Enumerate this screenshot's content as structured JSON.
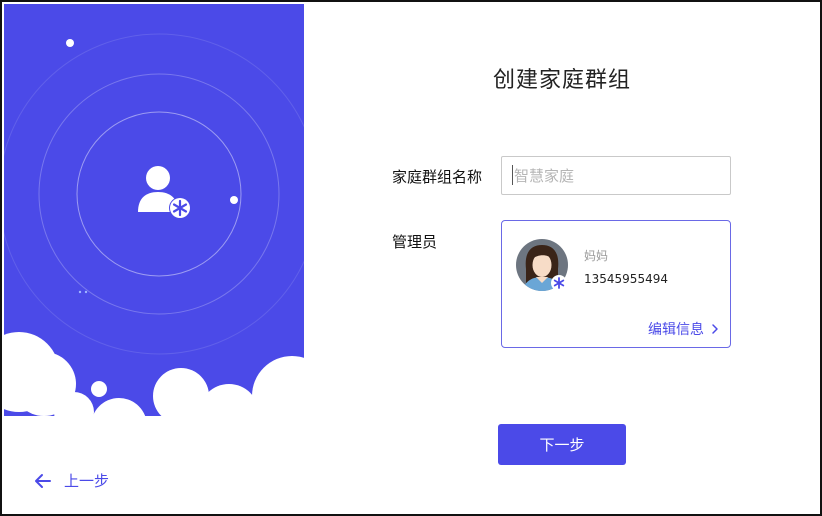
{
  "page": {
    "title": "创建家庭群组",
    "accent_color": "#4b4ae8"
  },
  "form": {
    "group_name_label": "家庭群组名称",
    "group_name_placeholder": "智慧家庭",
    "group_name_value": "",
    "admin_label": "管理员"
  },
  "admin": {
    "name": "妈妈",
    "phone": "13545955494",
    "edit_label": "编辑信息",
    "avatar_icon": "female-avatar",
    "badge_icon": "asterisk-badge-icon"
  },
  "actions": {
    "next_label": "下一步",
    "back_label": "上一步"
  },
  "illustration": {
    "icon": "group-add-icon",
    "background_color": "#4b4ae8"
  }
}
